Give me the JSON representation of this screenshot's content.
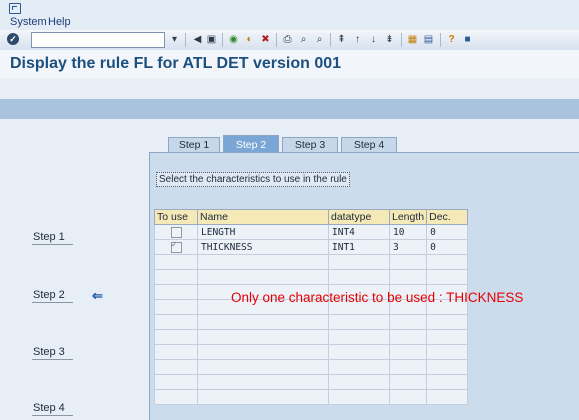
{
  "menubar": {
    "items": [
      "System",
      "Help"
    ]
  },
  "toolbar": {
    "enter_label": "✓",
    "command_value": "",
    "icons": [
      {
        "name": "input-history-icon",
        "glyph": "▾"
      },
      {
        "name": "back-arrow-icon",
        "glyph": "◀"
      },
      {
        "name": "save-icon",
        "glyph": "▣"
      },
      {
        "name": "green-back-icon",
        "glyph": "◉"
      },
      {
        "name": "exit-icon",
        "glyph": "◐"
      },
      {
        "name": "cancel-icon",
        "glyph": "✖"
      },
      {
        "name": "print-icon",
        "glyph": "⎙"
      },
      {
        "name": "find-icon",
        "glyph": "⌕"
      },
      {
        "name": "find-next-icon",
        "glyph": "⌕"
      },
      {
        "name": "first-page-icon",
        "glyph": "⇞"
      },
      {
        "name": "previous-page-icon",
        "glyph": "↑"
      },
      {
        "name": "next-page-icon",
        "glyph": "↓"
      },
      {
        "name": "last-page-icon",
        "glyph": "⇟"
      },
      {
        "name": "create-session-icon",
        "glyph": "▦"
      },
      {
        "name": "shortcut-icon",
        "glyph": "▤"
      },
      {
        "name": "help-icon",
        "glyph": "?"
      },
      {
        "name": "layout-icon",
        "glyph": "■"
      }
    ]
  },
  "page": {
    "title": "Display the rule FL for ATL DET version 001"
  },
  "tabs": [
    "Step 1",
    "Step 2",
    "Step 3",
    "Step 4"
  ],
  "panel": {
    "instruction": "Select the characteristics to use in the rule"
  },
  "table": {
    "columns": [
      "To use",
      "Name",
      "datatype",
      "Length",
      "Dec."
    ],
    "rows": [
      {
        "to_use": false,
        "name": "LENGTH",
        "datatype": "INT4",
        "length": "10",
        "dec": "0"
      },
      {
        "to_use": true,
        "name": "THICKNESS",
        "datatype": "INT1",
        "length": "3",
        "dec": "0"
      }
    ]
  },
  "steps": [
    "Step 1",
    "Step 2",
    "Step 3",
    "Step 4"
  ],
  "annotation": "Only one characteristic to be used : THICKNESS",
  "colors": {
    "title": "#1d4f7f",
    "annotation": "#e60000",
    "active_tab": "#7aa6d6",
    "header_row": "#f5e9b8"
  }
}
